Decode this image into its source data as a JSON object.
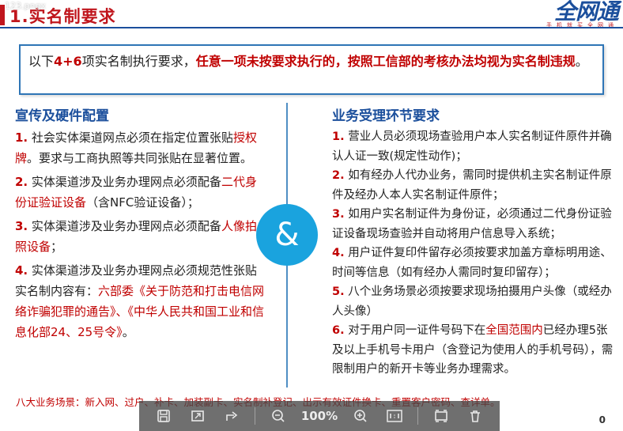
{
  "viewer": {
    "file_label": "123.pngx",
    "zoom": "100%",
    "page_number": "0"
  },
  "slide": {
    "title": "1.实名制要求",
    "logo": {
      "main": "全网通",
      "sub": "手机就买全网通"
    },
    "notice": {
      "part1": "以下",
      "count": "4+6",
      "part2": "项实名制执行要求，",
      "emphasis": "任意一项未按要求执行的，按照工信部的考核办法均视为实名制违规",
      "end": "。"
    },
    "left": {
      "heading": "宣传及硬件配置",
      "items": [
        {
          "num": "1.",
          "text_a": "社会实体渠道网点必须在指定位置张贴",
          "red": "授权牌",
          "text_b": "。要求与工商执照等共同张贴在显著位置。"
        },
        {
          "num": "2.",
          "text_a": "实体渠道涉及业务办理网点必须配备",
          "red": "二代身份证验证设备",
          "text_b": "（含NFC验证设备）；"
        },
        {
          "num": "3.",
          "text_a": "实体渠道涉及业务办理网点必须配备",
          "red": "人像拍照设备",
          "text_b": "；"
        },
        {
          "num": "4.",
          "text_a": "实体渠道涉及业务办理网点必须规范性张贴实名制内容有：",
          "red": "六部委《关于防范和打击电信网络诈骗犯罪的通告》、《中华人民共和国工业和信息化部24、25号令》",
          "text_b": "。"
        }
      ]
    },
    "center_symbol": "&",
    "right": {
      "heading": "业务受理环节要求",
      "items": [
        {
          "num": "1.",
          "text_a": "营业人员必须现场查验用户本人实名制证件原件并确认人证一致(规定性动作)；",
          "red": "",
          "text_b": ""
        },
        {
          "num": "2.",
          "text_a": "如有经办人代办业务，需同时提供机主实名制证件原件及经办人本人实名制证件原件；",
          "red": "",
          "text_b": ""
        },
        {
          "num": "3.",
          "text_a": "如用户实名制证件为身份证，必须通过二代身份证验证设备现场查验并自动将用户信息导入系统；",
          "red": "",
          "text_b": ""
        },
        {
          "num": "4.",
          "text_a": "用户证件复印件留存必须按要求加盖方章标明用途、时间等信息（如有经办人需同时复印留存）；",
          "red": "",
          "text_b": ""
        },
        {
          "num": "5.",
          "text_a": "八个业务场景必须按要求现场拍摄用户头像（或经办人头像）",
          "red": "",
          "text_b": ""
        },
        {
          "num": "6.",
          "text_a": "对于用户同一证件号码下在",
          "red": "全国范围内",
          "text_b": "已经办理5张及以上手机号卡用户（含登记为使用人的手机号码），需限制用户的新开卡等业务办理需求。"
        }
      ]
    },
    "footer_note": "八大业务场景：新入网、过户、补卡、加装副卡、实名制补登记、出示有效证件换卡、重置客户密码、查详单。"
  },
  "colors": {
    "title_red": "#c0161d",
    "heading_blue": "#1b4f9c",
    "accent_cyan": "#1aa3de",
    "emphasis_red": "#c00000"
  },
  "icons": [
    "save-icon",
    "fit-screen-icon",
    "share-icon",
    "zoom-out-icon",
    "zoom-in-icon",
    "actual-size-icon",
    "fullscreen-icon",
    "delete-icon"
  ]
}
